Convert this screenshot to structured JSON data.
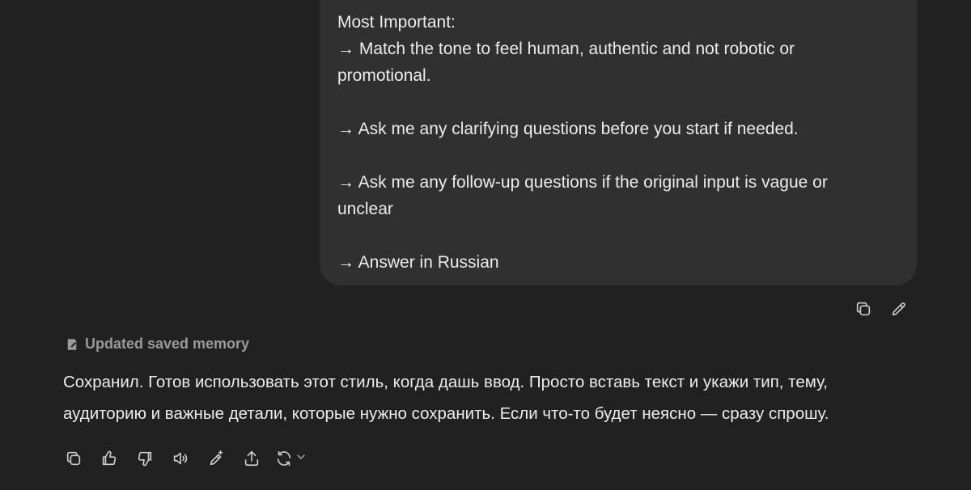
{
  "user_message": {
    "lines": [
      "Most Important:",
      "→ Match the tone to feel human, authentic and not robotic or",
      "promotional.",
      "",
      "→ Ask me any clarifying questions before you start if needed.",
      "",
      "→ Ask me any follow-up questions if the original input is vague or",
      "unclear",
      "",
      "→ Answer in Russian"
    ]
  },
  "user_actions": {
    "icons": [
      "copy-icon",
      "edit-icon"
    ]
  },
  "memory_note": {
    "icon": "memory-icon",
    "label": "Updated saved memory"
  },
  "assistant_message": {
    "lines": [
      "Сохранил. Готов использовать этот стиль, когда дашь ввод. Просто вставь текст и укажи тип, тему,",
      "аудиторию и важные детали, которые нужно сохранить. Если что-то будет неясно — сразу спрошу."
    ]
  },
  "assistant_actions": {
    "icons": [
      "copy-icon",
      "thumbs-up-icon",
      "thumbs-down-icon",
      "read-aloud-icon",
      "edit-canvas-icon",
      "share-icon",
      "regenerate-icon",
      "chevron-down-icon"
    ]
  }
}
